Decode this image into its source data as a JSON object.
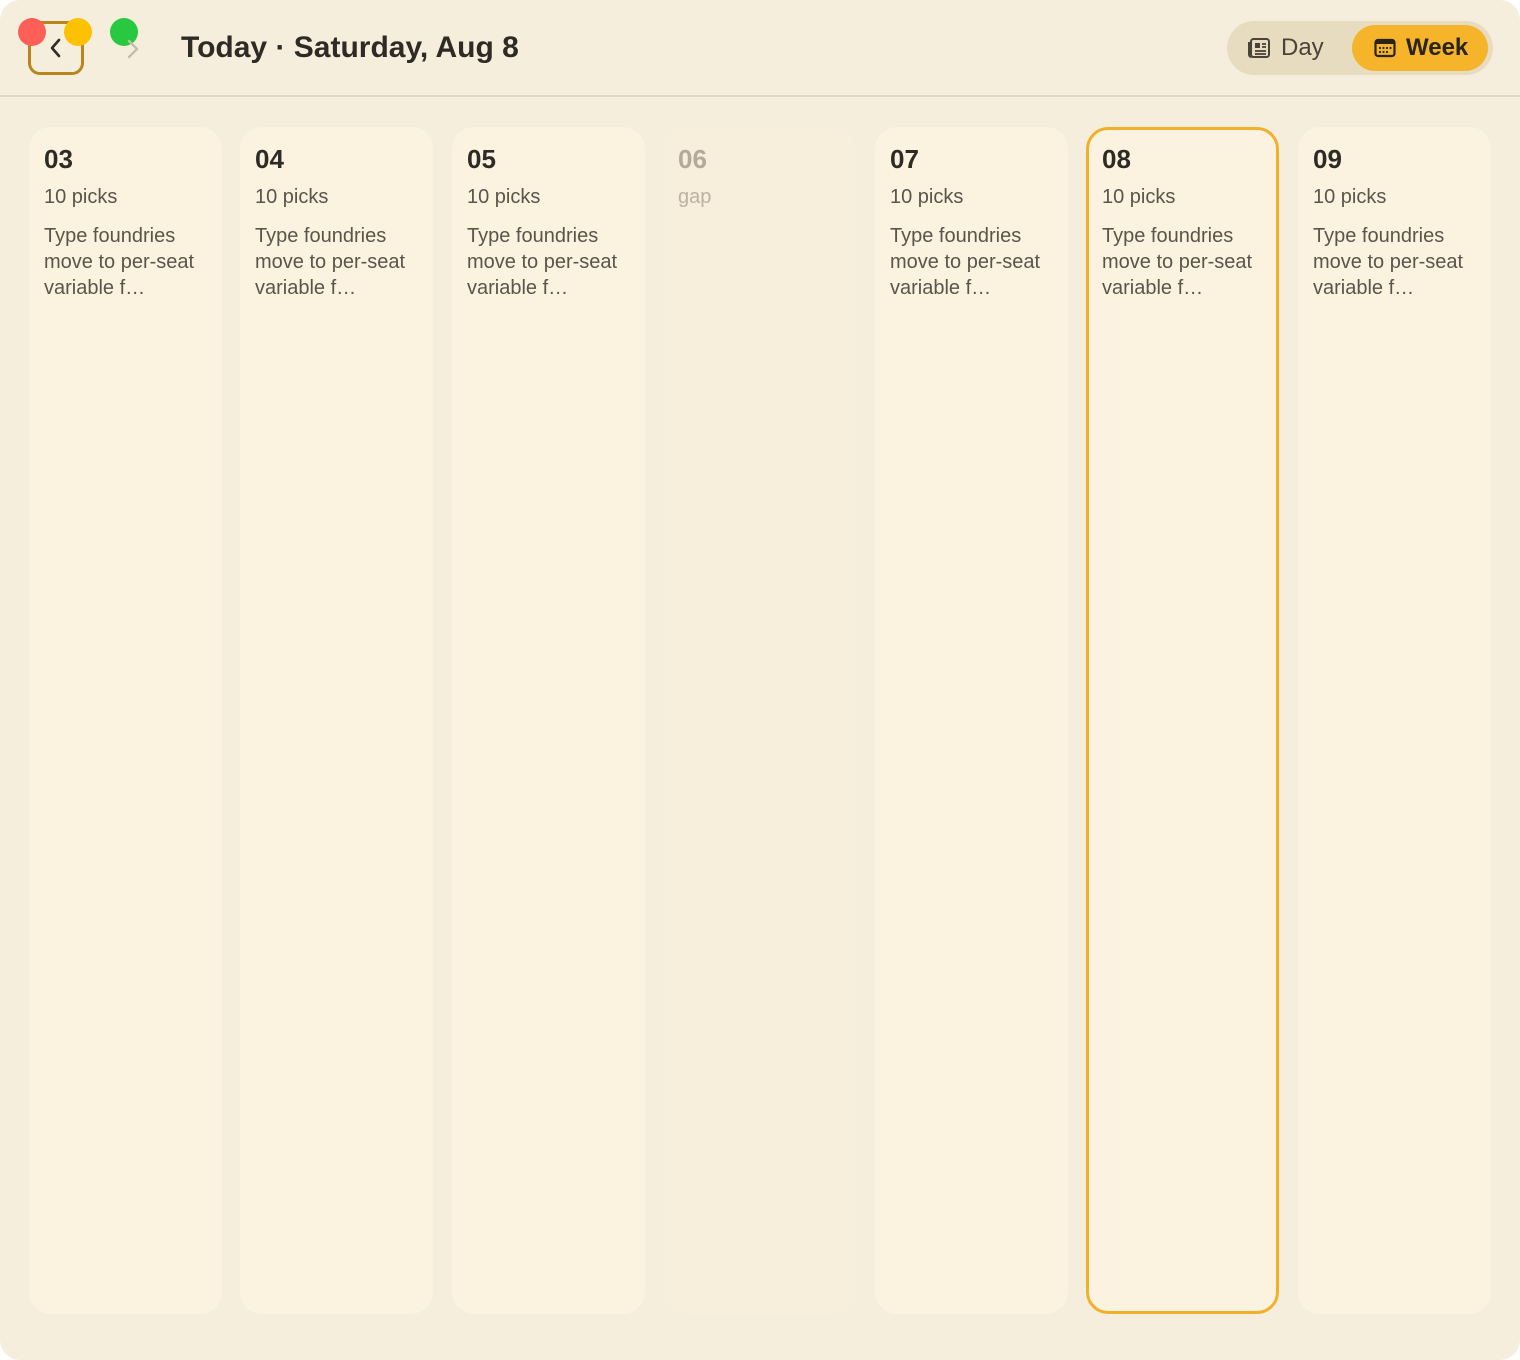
{
  "window": {
    "title": "Today · Saturday, Aug 8"
  },
  "toolbar": {
    "view_modes": [
      {
        "label": "Day",
        "icon": "newspaper-icon",
        "selected": false
      },
      {
        "label": "Week",
        "icon": "calendar-icon",
        "selected": true
      }
    ]
  },
  "colors": {
    "accent": "#f5b42a",
    "window_bg": "#f6eedc",
    "card_bg": "#fbf3e0",
    "selected_border": "#f1b02c",
    "back_button_border": "#b8861e"
  },
  "week": {
    "days": [
      {
        "date": "03",
        "picks": "10 picks",
        "summary": "Type foundries move to per-seat variable f…",
        "gap": false,
        "selected": false
      },
      {
        "date": "04",
        "picks": "10 picks",
        "summary": "Type foundries move to per-seat variable f…",
        "gap": false,
        "selected": false
      },
      {
        "date": "05",
        "picks": "10 picks",
        "summary": "Type foundries move to per-seat variable f…",
        "gap": false,
        "selected": false
      },
      {
        "date": "06",
        "picks": "gap",
        "summary": "",
        "gap": true,
        "selected": false
      },
      {
        "date": "07",
        "picks": "10 picks",
        "summary": "Type foundries move to per-seat variable f…",
        "gap": false,
        "selected": false
      },
      {
        "date": "08",
        "picks": "10 picks",
        "summary": "Type foundries move to per-seat variable f…",
        "gap": false,
        "selected": true
      },
      {
        "date": "09",
        "picks": "10 picks",
        "summary": "Type foundries move to per-seat variable f…",
        "gap": false,
        "selected": false
      }
    ]
  }
}
